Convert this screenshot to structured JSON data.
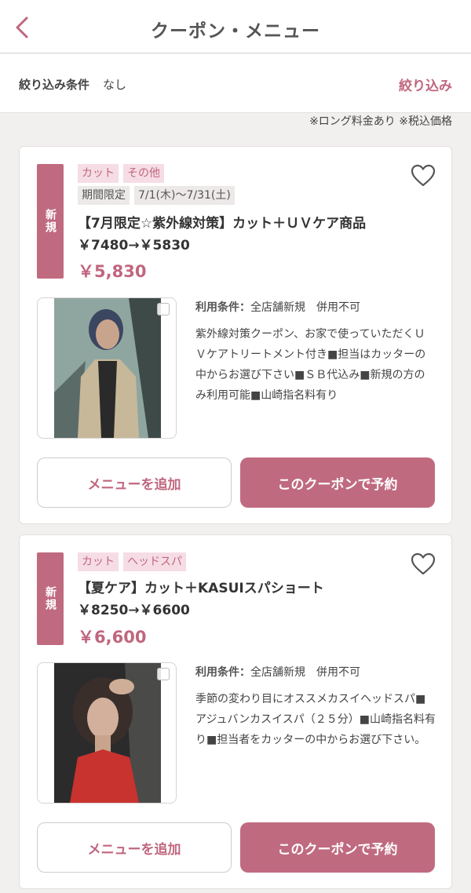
{
  "header": {
    "title": "クーポン・メニュー"
  },
  "filter": {
    "label": "絞り込み条件",
    "value": "なし",
    "button": "絞り込み"
  },
  "note": "※ロング料金あり ※税込価格",
  "colors": {
    "accent": "#c0667f",
    "ribbon": "#c06a80",
    "tag_bg": "#f6dde5"
  },
  "coupons": [
    {
      "badge": "新規",
      "tags": [
        "カット",
        "その他"
      ],
      "limited_label": "期間限定",
      "limited_period": "7/1(木)〜7/31(土)",
      "title": "【7月限定☆紫外線対策】カット＋ＵＶケア商品￥7480→￥5830",
      "price": "￥5,830",
      "condition_label": "利用条件：",
      "condition_value": "全店舗新規　併用不可",
      "description": "紫外線対策クーポン、お家で使っていただくＵＶケアトリートメント付き■担当はカッターの中からお選び下さい■ＳＢ代込み■新規の方のみ利用可能■山崎指名料有り",
      "add_button": "メニューを追加",
      "book_button": "このクーポンで予約"
    },
    {
      "badge": "新規",
      "tags": [
        "カット",
        "ヘッドスパ"
      ],
      "title": "【夏ケア】カット＋KASUIスパショート￥8250→￥6600",
      "price": "￥6,600",
      "condition_label": "利用条件：",
      "condition_value": "全店舗新規　併用不可",
      "description": "季節の変わり目にオススメカスイヘッドスパ■アジュバンカスイスパ（２５分）■山崎指名料有り■担当者をカッターの中からお選び下さい。",
      "add_button": "メニューを追加",
      "book_button": "このクーポンで予約"
    }
  ]
}
